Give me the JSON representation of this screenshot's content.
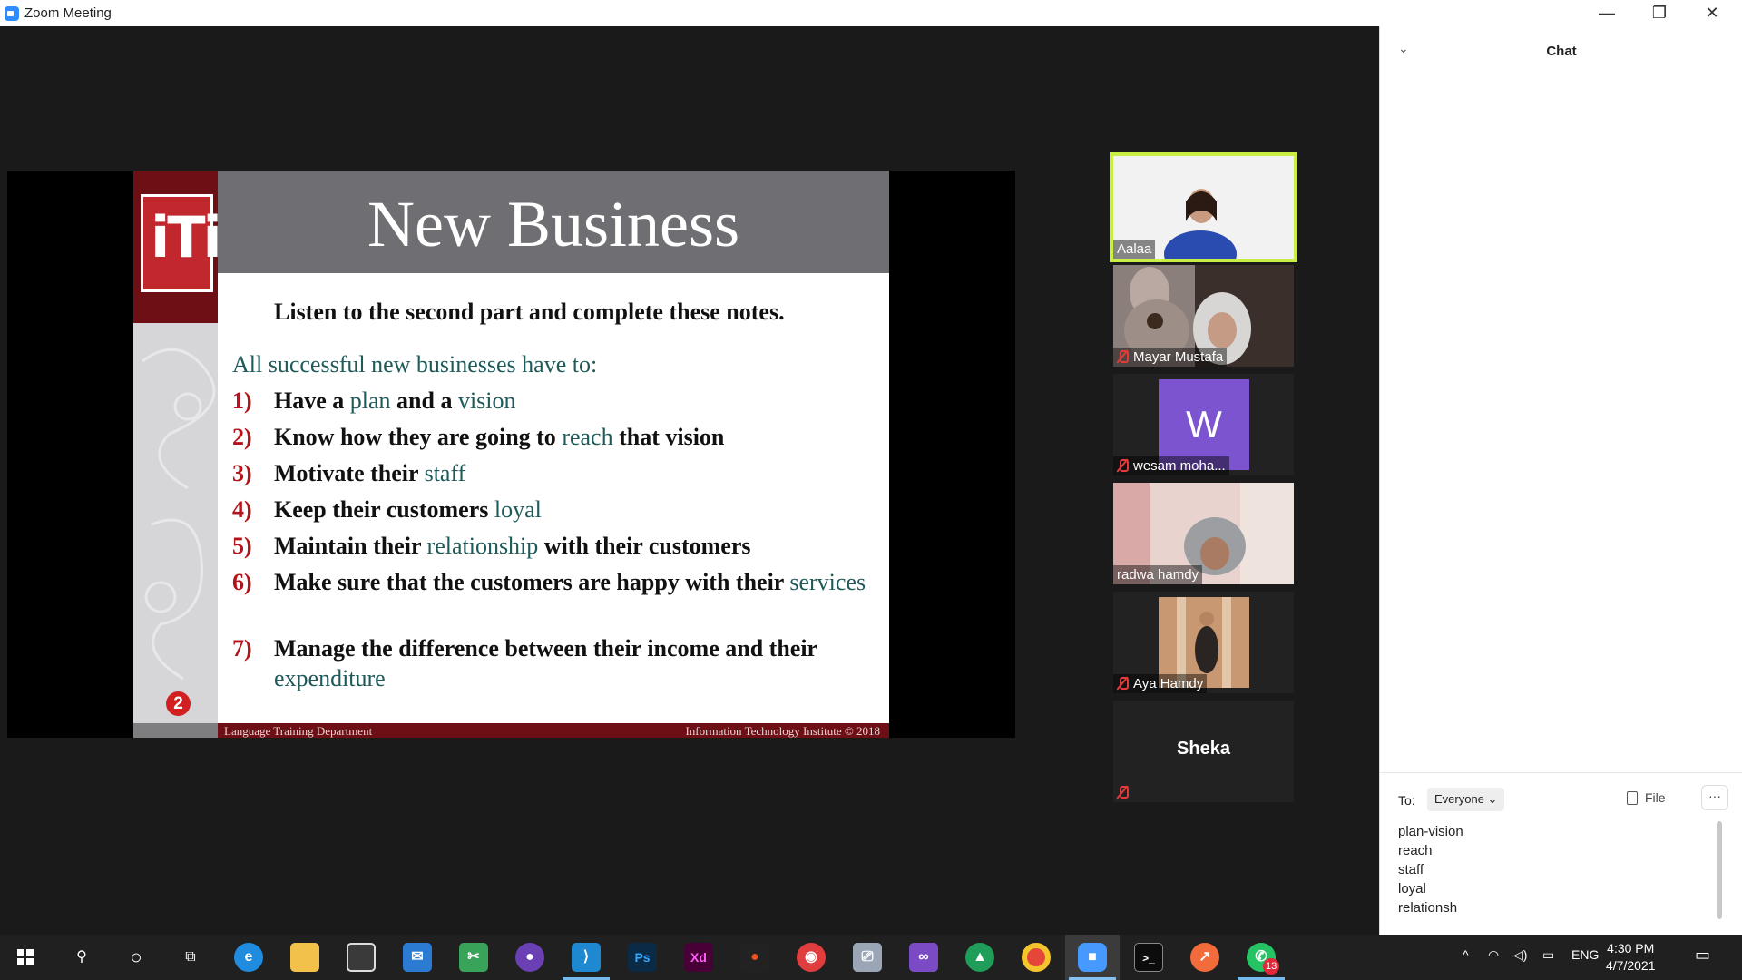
{
  "window": {
    "title": "Zoom Meeting",
    "controls": {
      "minimize": "—",
      "restore": "❐",
      "close": "✕"
    }
  },
  "slide": {
    "title": "New Business",
    "logo_text": "iTi",
    "intro": "Listen to the second part and complete these notes.",
    "heading": "All successful new businesses have to:",
    "items": [
      {
        "num": "1)",
        "before": "Have a ",
        "answer": "plan",
        "middle": " and a ",
        "answer2": "vision",
        "after": ""
      },
      {
        "num": "2)",
        "before": "Know how they are going to ",
        "answer": "reach",
        "after": " that vision"
      },
      {
        "num": "3)",
        "before": "Motivate their ",
        "answer": "staff",
        "after": ""
      },
      {
        "num": "4)",
        "before": "Keep their customers ",
        "answer": "loyal",
        "after": ""
      },
      {
        "num": "5)",
        "before": "Maintain their ",
        "answer": "relationship",
        "after": " with their customers"
      },
      {
        "num": "6)",
        "before": "Make sure that the customers are happy with their ",
        "answer": "services",
        "after": ""
      },
      {
        "num": "7)",
        "before": "Manage the difference between their income and their ",
        "answer": "expenditure",
        "after": ""
      }
    ],
    "page_marker": "2",
    "footer_left": "Language Training Department",
    "footer_right": "Information Technology Institute © 2018"
  },
  "participants": [
    {
      "name": "Aalaa",
      "muted": false,
      "active": true,
      "type": "video"
    },
    {
      "name": "Mayar Mustafa",
      "muted": true,
      "active": false,
      "type": "video"
    },
    {
      "name": "wesam moha...",
      "muted": true,
      "active": false,
      "type": "avatar",
      "avatar_letter": "W"
    },
    {
      "name": "radwa hamdy",
      "muted": false,
      "active": false,
      "type": "video"
    },
    {
      "name": "Aya Hamdy",
      "muted": true,
      "active": false,
      "type": "video"
    },
    {
      "name": "Sheka",
      "muted": true,
      "active": false,
      "type": "name-only"
    }
  ],
  "chat": {
    "title": "Chat",
    "collapse_icon": "chevron-down",
    "to_label": "To:",
    "recipient": "Everyone",
    "file_label": "File",
    "more_label": "···",
    "draft_lines": [
      "plan-vision",
      "reach",
      "staff",
      "loyal",
      "relationsh"
    ]
  },
  "taskbar": {
    "apps": [
      "windows-start",
      "search",
      "cortana",
      "task-view",
      "edge",
      "file-explorer",
      "store",
      "mail",
      "snip",
      "github-desktop",
      "vscode",
      "photoshop",
      "adobe-xd",
      "figma",
      "zoom-rooms",
      "remote-desktop",
      "visual-studio",
      "git-kraken",
      "chrome",
      "zoom",
      "terminal",
      "postman",
      "whatsapp"
    ],
    "whatsapp_badge": "13",
    "tray": {
      "lang": "ENG"
    },
    "time": "4:30 PM",
    "date": "4/7/2021"
  },
  "colors": {
    "slide_maroon": "#6e0f15",
    "slide_answer": "#1e5a5a",
    "slide_number": "#b3141b",
    "active_speaker": "#c9ee44",
    "avatar_purple": "#7c54cf"
  }
}
